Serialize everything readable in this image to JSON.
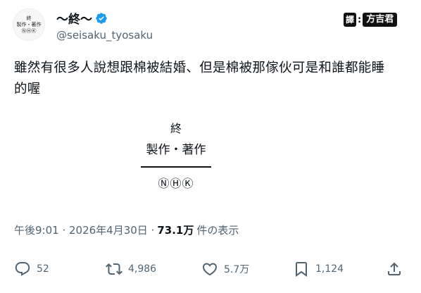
{
  "author": {
    "avatar_lines": [
      "終",
      "製作・著作",
      "ⓃⒽⓀ"
    ],
    "display_name": "〜終〜",
    "handle": "@seisaku_tyosaku"
  },
  "translator": {
    "badge": "譯",
    "separator": ":",
    "name": "方吉君"
  },
  "tweet": {
    "text_line1": "雖然有很多人說想跟棉被結婚、但是棉被那傢伙可是和誰都能睡",
    "text_line2": "的喔"
  },
  "media": {
    "top": "終",
    "title": "製作・著作",
    "marks": "ⓃⒽⓀ"
  },
  "meta": {
    "timestamp": "午後9:01 · 2026年4月30日 ·",
    "views": "73.1万",
    "views_suffix": "件の表示"
  },
  "actions": {
    "replies": "52",
    "reposts": "4,986",
    "likes": "5.7万",
    "bookmarks": "1,124"
  },
  "icons": {
    "reply": "reply-icon",
    "repost": "repost-icon",
    "like": "heart-icon",
    "bookmark": "bookmark-icon",
    "share": "share-icon",
    "verified": "verified-badge-icon"
  },
  "colors": {
    "verified": "#1d9bf0",
    "secondary_text": "#536471",
    "primary_text": "#0f1419"
  }
}
